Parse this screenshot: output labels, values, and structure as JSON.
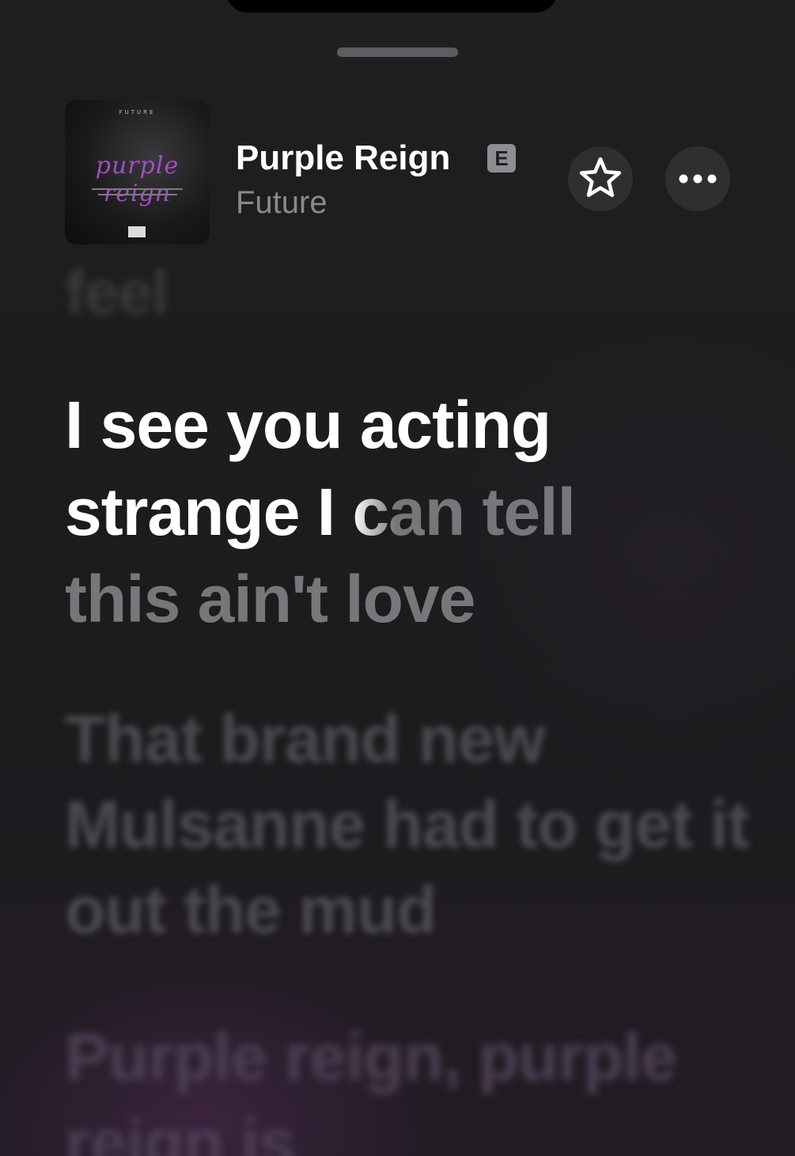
{
  "now_playing": {
    "title": "Purple Reign",
    "explicit_badge": "E",
    "artist": "Future",
    "artwork": {
      "artist_text": "FUTURE",
      "title_text": "purple reign"
    }
  },
  "actions": {
    "favorite_icon": "star-icon",
    "more_icon": "ellipsis-icon"
  },
  "lyrics": {
    "previous_line": "feel",
    "current_line": {
      "sung_part_1": "I see you acting",
      "sung_part_2": "strange I ",
      "transition": "ca",
      "unsung_part_1": "n tell",
      "unsung_part_2": "this ain't love"
    },
    "next_line_1": "That brand new Mulsanne had to get it out the mud",
    "next_line_2": "Purple reign, purple reign is"
  },
  "colors": {
    "background": "#1e1d1f",
    "sung_text": "#ffffff",
    "unsung_text": "#77767a",
    "artwork_accent": "#a24ec0"
  }
}
